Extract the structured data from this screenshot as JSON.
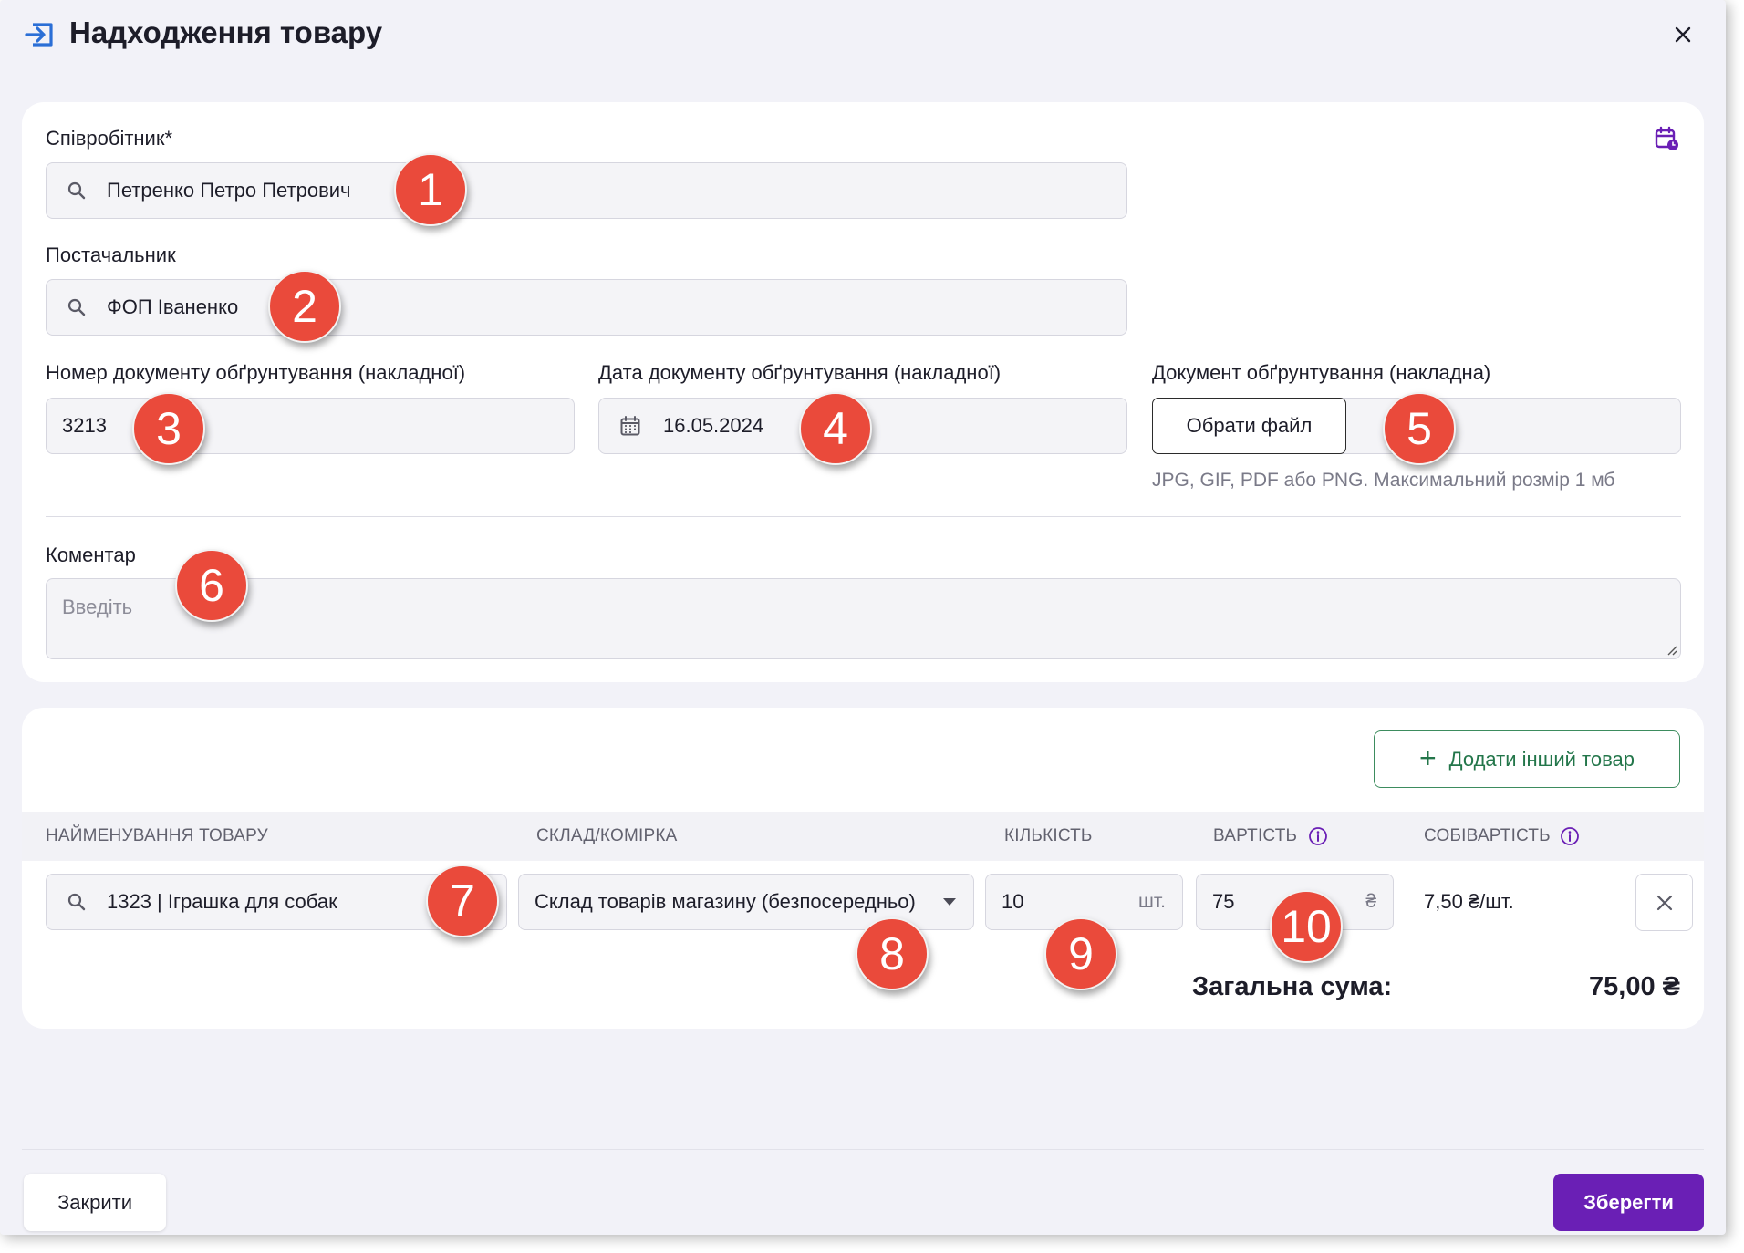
{
  "header": {
    "title": "Надходження товару",
    "close_glyph": "×"
  },
  "form": {
    "employee": {
      "label": "Співробітник*",
      "value": "Петренко Петро Петрович"
    },
    "supplier": {
      "label": "Постачальник",
      "value": "ФОП Іваненко"
    },
    "doc_number": {
      "label": "Номер документу обґрунтування (накладної)",
      "value": "3213"
    },
    "doc_date": {
      "label": "Дата документу обґрунтування (накладної)",
      "value": "16.05.2024"
    },
    "doc_file": {
      "label": "Документ обґрунтування (накладна)",
      "button": "Обрати файл",
      "hint": "JPG, GIF, PDF або PNG. Максимальний розмір 1 мб"
    },
    "comment": {
      "label": "Коментар",
      "placeholder": "Введіть"
    }
  },
  "products": {
    "add_button": "Додати інший товар",
    "columns": {
      "name": "НАЙМЕНУВАННЯ ТОВАРУ",
      "warehouse": "СКЛАД/КОМІРКА",
      "quantity": "КІЛЬКІСТЬ",
      "price": "ВАРТІСТЬ",
      "cost": "СОБІВАРТІСТЬ"
    },
    "row": {
      "name": "1323 | Іграшка для собак",
      "warehouse": "Склад товарів магазину (безпосередньо)",
      "quantity": "10",
      "quantity_unit": "шт.",
      "price": "75",
      "price_unit": "₴",
      "cost": "7,50 ₴/шт."
    },
    "total_label": "Загальна сума:",
    "total_value": "75,00 ₴"
  },
  "footer": {
    "close": "Закрити",
    "save": "Зберегти"
  },
  "badges": [
    "1",
    "2",
    "3",
    "4",
    "5",
    "6",
    "7",
    "8",
    "9",
    "10"
  ],
  "colors": {
    "accent": "#6a1fb5",
    "green": "#23764a",
    "badge": "#ea4a3b",
    "icon_blue": "#2b6fd6"
  }
}
